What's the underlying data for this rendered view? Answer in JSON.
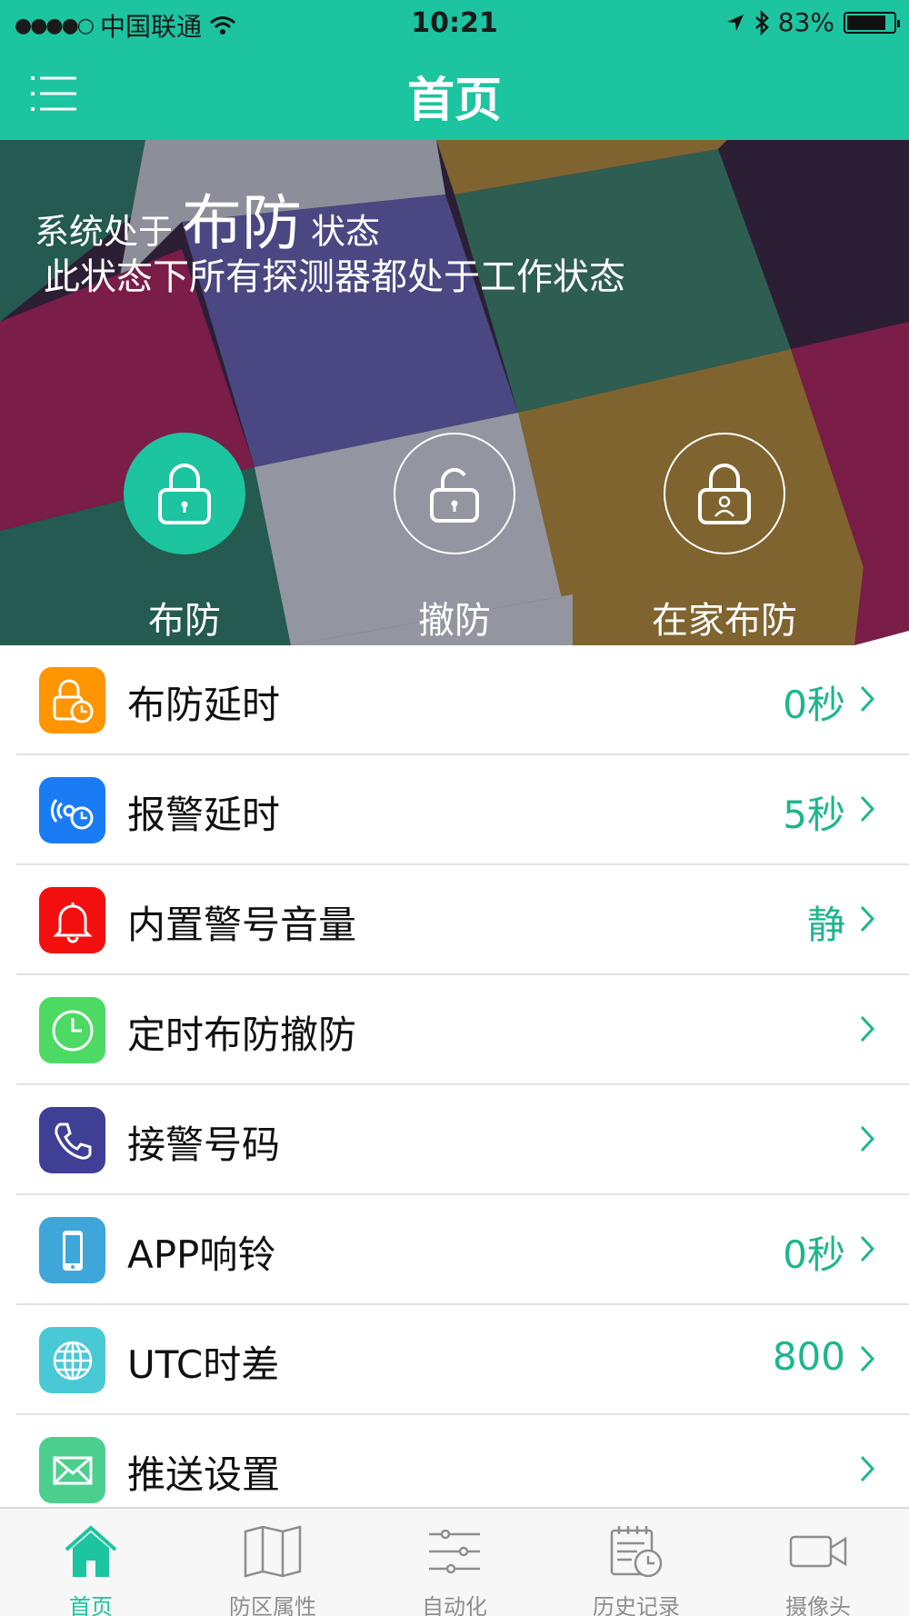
{
  "status_bar": {
    "signal": "●●●●○",
    "carrier": "中国联通",
    "time": "10:21",
    "battery_percent": "83%",
    "battery_level": 0.83
  },
  "nav": {
    "title": "首页",
    "menu_icon": "hamburger-menu-icon"
  },
  "hero": {
    "status_prefix": "系统处于",
    "status_mode": "布防",
    "status_suffix": "状态",
    "description": "此状态下所有探测器都处于工作状态",
    "modes": [
      {
        "label": "布防",
        "icon": "lock-closed-icon",
        "active": true
      },
      {
        "label": "撤防",
        "icon": "lock-open-icon",
        "active": false
      },
      {
        "label": "在家布防",
        "icon": "lock-person-icon",
        "active": false
      }
    ]
  },
  "settings": [
    {
      "label": "布防延时",
      "value": "0秒",
      "icon": "lock-timer-icon",
      "color": "#ff9500"
    },
    {
      "label": "报警延时",
      "value": "5秒",
      "icon": "alarm-timer-icon",
      "color": "#1a7cf5"
    },
    {
      "label": "内置警号音量",
      "value": "静",
      "icon": "bell-icon",
      "color": "#f40f0f"
    },
    {
      "label": "定时布防撤防",
      "value": "",
      "icon": "clock-icon",
      "color": "#4cd964"
    },
    {
      "label": "接警号码",
      "value": "",
      "icon": "phone-icon",
      "color": "#3f3f95"
    },
    {
      "label": "APP响铃",
      "value": "0秒",
      "icon": "mobile-phone-icon",
      "color": "#3ea6d8"
    },
    {
      "label": "UTC时差",
      "value": "800",
      "icon": "globe-icon",
      "color": "#49c9d6"
    },
    {
      "label": "推送设置",
      "value": "",
      "icon": "envelope-icon",
      "color": "#4ccf8e"
    }
  ],
  "tabs": [
    {
      "label": "首页",
      "icon": "home-icon",
      "active": true
    },
    {
      "label": "防区属性",
      "icon": "map-icon",
      "active": false
    },
    {
      "label": "自动化",
      "icon": "sliders-icon",
      "active": false
    },
    {
      "label": "历史记录",
      "icon": "history-icon",
      "active": false
    },
    {
      "label": "摄像头",
      "icon": "camera-icon",
      "active": false
    }
  ],
  "colors": {
    "accent": "#1cc4a0",
    "value_text": "#1cb68e",
    "tab_inactive": "#8e8e8e"
  }
}
